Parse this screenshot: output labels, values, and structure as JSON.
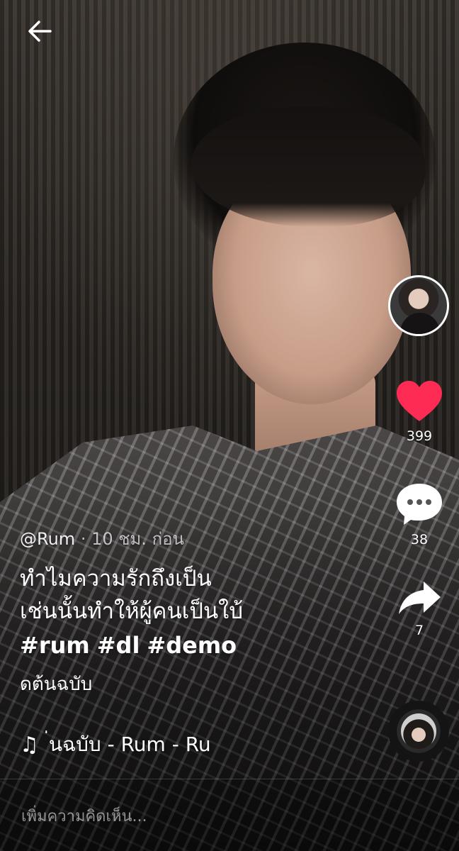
{
  "nav": {
    "back_icon": "back-arrow-icon"
  },
  "creator": {
    "avatar_alt": "creator-avatar"
  },
  "actions": {
    "like": {
      "icon": "heart-icon",
      "count": "399",
      "color": "#fe2c55"
    },
    "comment": {
      "icon": "comment-bubble-icon",
      "count": "38"
    },
    "share": {
      "icon": "share-arrow-icon",
      "count": "7"
    }
  },
  "post": {
    "username": "@Rum",
    "separator": " · ",
    "time": "10 ชม. ก่อน",
    "desc_line1": "ทำไมความรักถึงเป็น",
    "desc_line2": "เช่นนั้นทำให้ผู้คนเป็นใบ้",
    "hashtags": [
      "#rum",
      "#dl",
      "#demo"
    ],
    "extra_line": "ดต้นฉบับ"
  },
  "music": {
    "icon": "music-note-icon",
    "note_glyph": "♫",
    "title": "่นฉบับ - Rum - Ru"
  },
  "comment_bar": {
    "placeholder": "เพิ่มความคิดเห็น..."
  }
}
